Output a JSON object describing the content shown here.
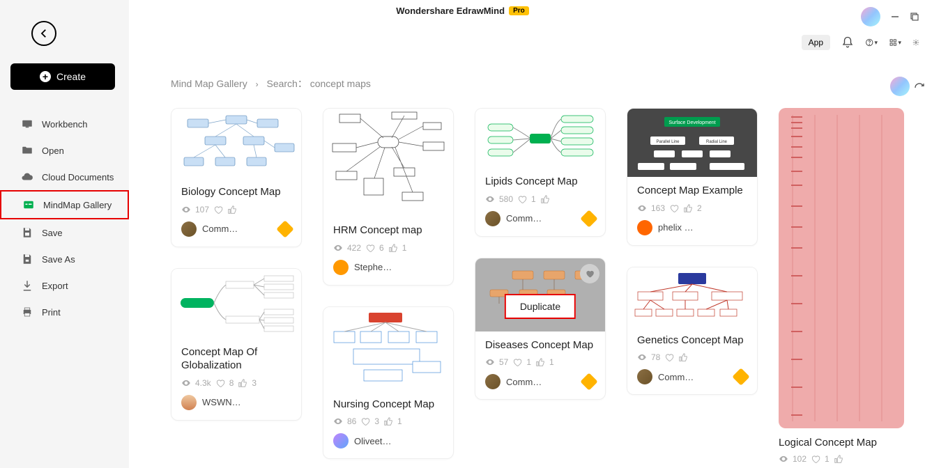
{
  "titlebar": {
    "title": "Wondershare EdrawMind",
    "pro": "Pro"
  },
  "toolbar": {
    "app": "App"
  },
  "sidebar": {
    "create": "Create",
    "items": [
      {
        "label": "Workbench"
      },
      {
        "label": "Open"
      },
      {
        "label": "Cloud Documents"
      },
      {
        "label": "MindMap Gallery"
      },
      {
        "label": "Save"
      },
      {
        "label": "Save As"
      },
      {
        "label": "Export"
      },
      {
        "label": "Print"
      }
    ]
  },
  "breadcrumb": {
    "root": "Mind Map Gallery",
    "search_prefix": "Search：",
    "query": "concept maps"
  },
  "cards": {
    "biology": {
      "title": "Biology Concept Map",
      "views": "107",
      "author": "Comm…"
    },
    "globalization": {
      "title": "Concept Map Of Globalization",
      "views": "4.3k",
      "hearts": "8",
      "thumbs": "3",
      "author": "WSWN…"
    },
    "hrm": {
      "title": "HRM Concept map",
      "views": "422",
      "hearts": "6",
      "thumbs": "1",
      "author": "Stephe…"
    },
    "nursing": {
      "title": "Nursing Concept Map",
      "views": "86",
      "hearts": "3",
      "thumbs": "1",
      "author": "Oliveet…"
    },
    "lipids": {
      "title": "Lipids Concept Map",
      "views": "580",
      "hearts": "1",
      "author": "Comm…"
    },
    "diseases": {
      "title": "Diseases Concept Map",
      "views": "57",
      "hearts": "1",
      "thumbs": "1",
      "author": "Comm…",
      "badge": "Duplicate"
    },
    "example": {
      "title": "Concept Map Example",
      "views": "163",
      "thumbs": "2",
      "author": "phelix …"
    },
    "genetics": {
      "title": "Genetics Concept Map",
      "views": "78",
      "author": "Comm…"
    },
    "logical": {
      "title": "Logical Concept Map",
      "views": "102",
      "hearts": "1"
    },
    "surface_dev_label": "Surface Development",
    "parallel_line": "Parallel Line",
    "radial_line": "Radial Line"
  }
}
